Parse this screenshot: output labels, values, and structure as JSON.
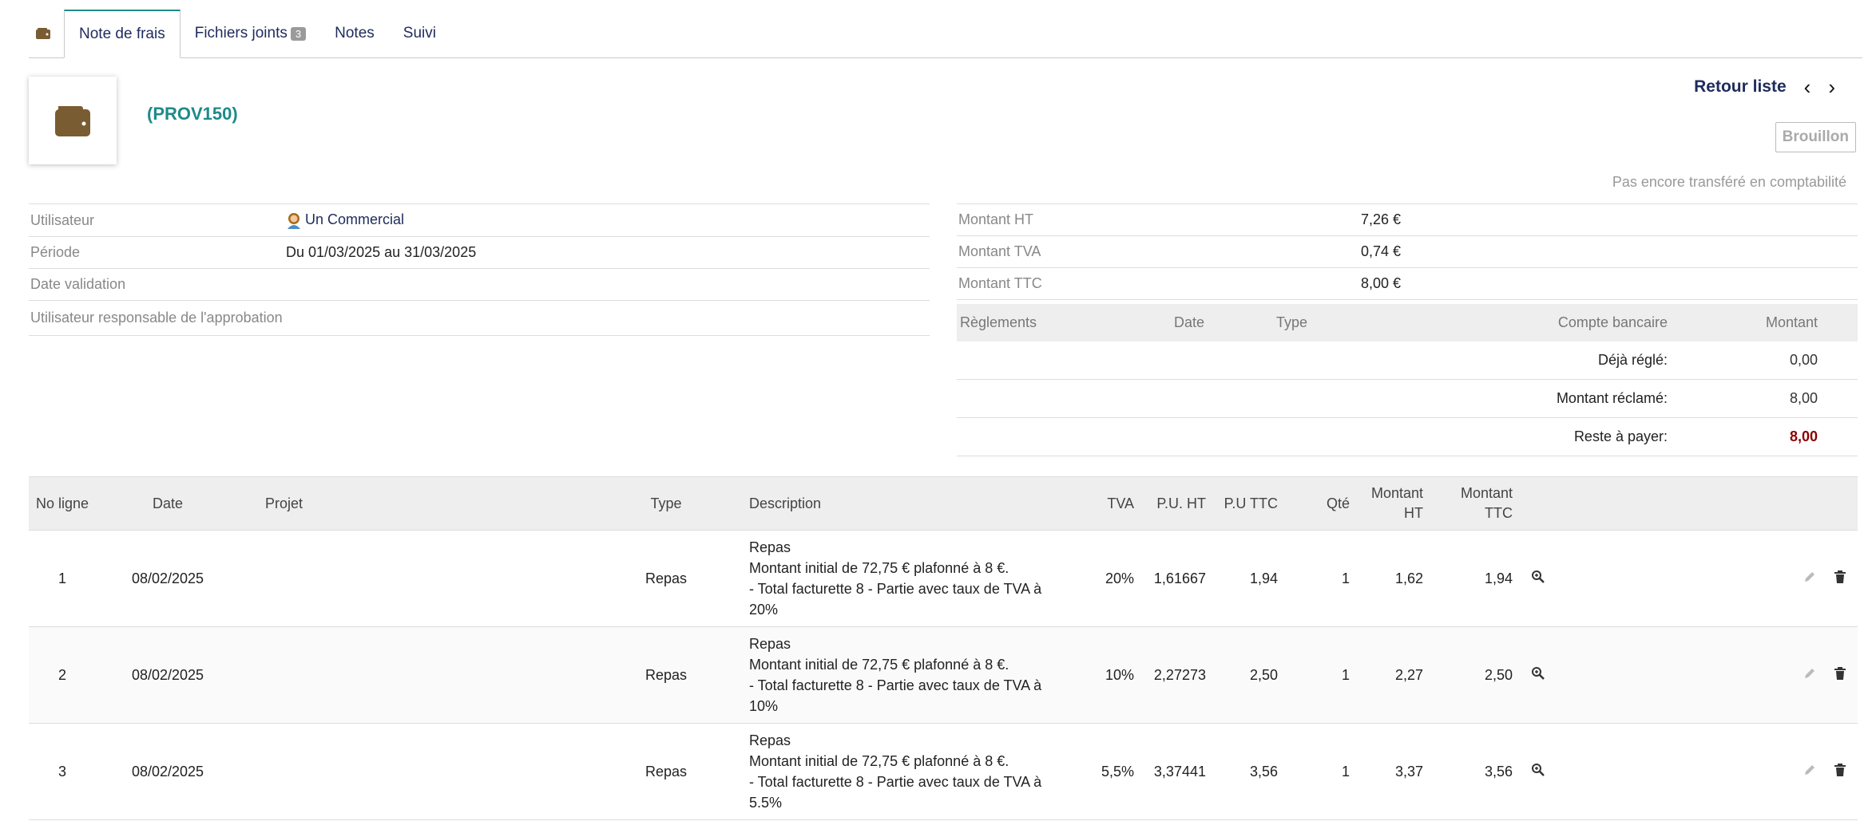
{
  "tabs": [
    {
      "label": "Note de frais"
    },
    {
      "label": "Fichiers joints",
      "badge": "3"
    },
    {
      "label": "Notes"
    },
    {
      "label": "Suivi"
    }
  ],
  "header": {
    "ref": "(PROV150)",
    "back_label": "Retour liste",
    "status": "Brouillon",
    "transfer_note": "Pas encore transféré en comptabilité"
  },
  "info": {
    "user_label": "Utilisateur",
    "user_value": "Un Commercial",
    "period_label": "Période",
    "period_value": "Du 01/03/2025 au 31/03/2025",
    "validation_label": "Date validation",
    "approver_label": "Utilisateur responsable de l'approbation"
  },
  "amounts": {
    "ht_label": "Montant HT",
    "ht_value": "7,26 €",
    "tva_label": "Montant TVA",
    "tva_value": "0,74 €",
    "ttc_label": "Montant TTC",
    "ttc_value": "8,00 €"
  },
  "payments": {
    "headers": [
      "Règlements",
      "Date",
      "Type",
      "Compte bancaire",
      "Montant"
    ],
    "already_paid_label": "Déjà réglé:",
    "already_paid_value": "0,00",
    "claimed_label": "Montant réclamé:",
    "claimed_value": "8,00",
    "remaining_label": "Reste à payer:",
    "remaining_value": "8,00"
  },
  "lines": {
    "headers": {
      "no": "No ligne",
      "date": "Date",
      "project": "Projet",
      "type": "Type",
      "description": "Description",
      "tva": "TVA",
      "pu_ht": "P.U. HT",
      "pu_ttc": "P.U TTC",
      "qty": "Qté",
      "amount_ht": "Montant HT",
      "amount_ttc": "Montant TTC"
    },
    "rows": [
      {
        "no": "1",
        "date": "08/02/2025",
        "project": "",
        "type": "Repas",
        "desc1": "Repas",
        "desc2": "Montant initial de 72,75 € plafonné à 8 €.",
        "desc3": "- Total facturette 8 - Partie avec taux de TVA à",
        "desc4": "20%",
        "tva": "20%",
        "pu_ht": "1,61667",
        "pu_ttc": "1,94",
        "qty": "1",
        "amount_ht": "1,62",
        "amount_ttc": "1,94"
      },
      {
        "no": "2",
        "date": "08/02/2025",
        "project": "",
        "type": "Repas",
        "desc1": "Repas",
        "desc2": "Montant initial de 72,75 € plafonné à 8 €.",
        "desc3": "- Total facturette 8 - Partie avec taux de TVA à",
        "desc4": "10%",
        "tva": "10%",
        "pu_ht": "2,27273",
        "pu_ttc": "2,50",
        "qty": "1",
        "amount_ht": "2,27",
        "amount_ttc": "2,50"
      },
      {
        "no": "3",
        "date": "08/02/2025",
        "project": "",
        "type": "Repas",
        "desc1": "Repas",
        "desc2": "Montant initial de 72,75 € plafonné à 8 €.",
        "desc3": "- Total facturette 8 - Partie avec taux de TVA à",
        "desc4": "5.5%",
        "tva": "5,5%",
        "pu_ht": "3,37441",
        "pu_ttc": "3,56",
        "qty": "1",
        "amount_ht": "3,37",
        "amount_ttc": "3,56"
      }
    ]
  },
  "icons": {
    "wallet": "wallet-icon",
    "zoom": "zoom-icon",
    "edit": "pencil-icon",
    "delete": "trash-icon"
  },
  "colors": {
    "accent": "#1e8a89",
    "link": "#1e2b5c",
    "wallet": "#7a5c32",
    "remaining": "#8b0000"
  }
}
